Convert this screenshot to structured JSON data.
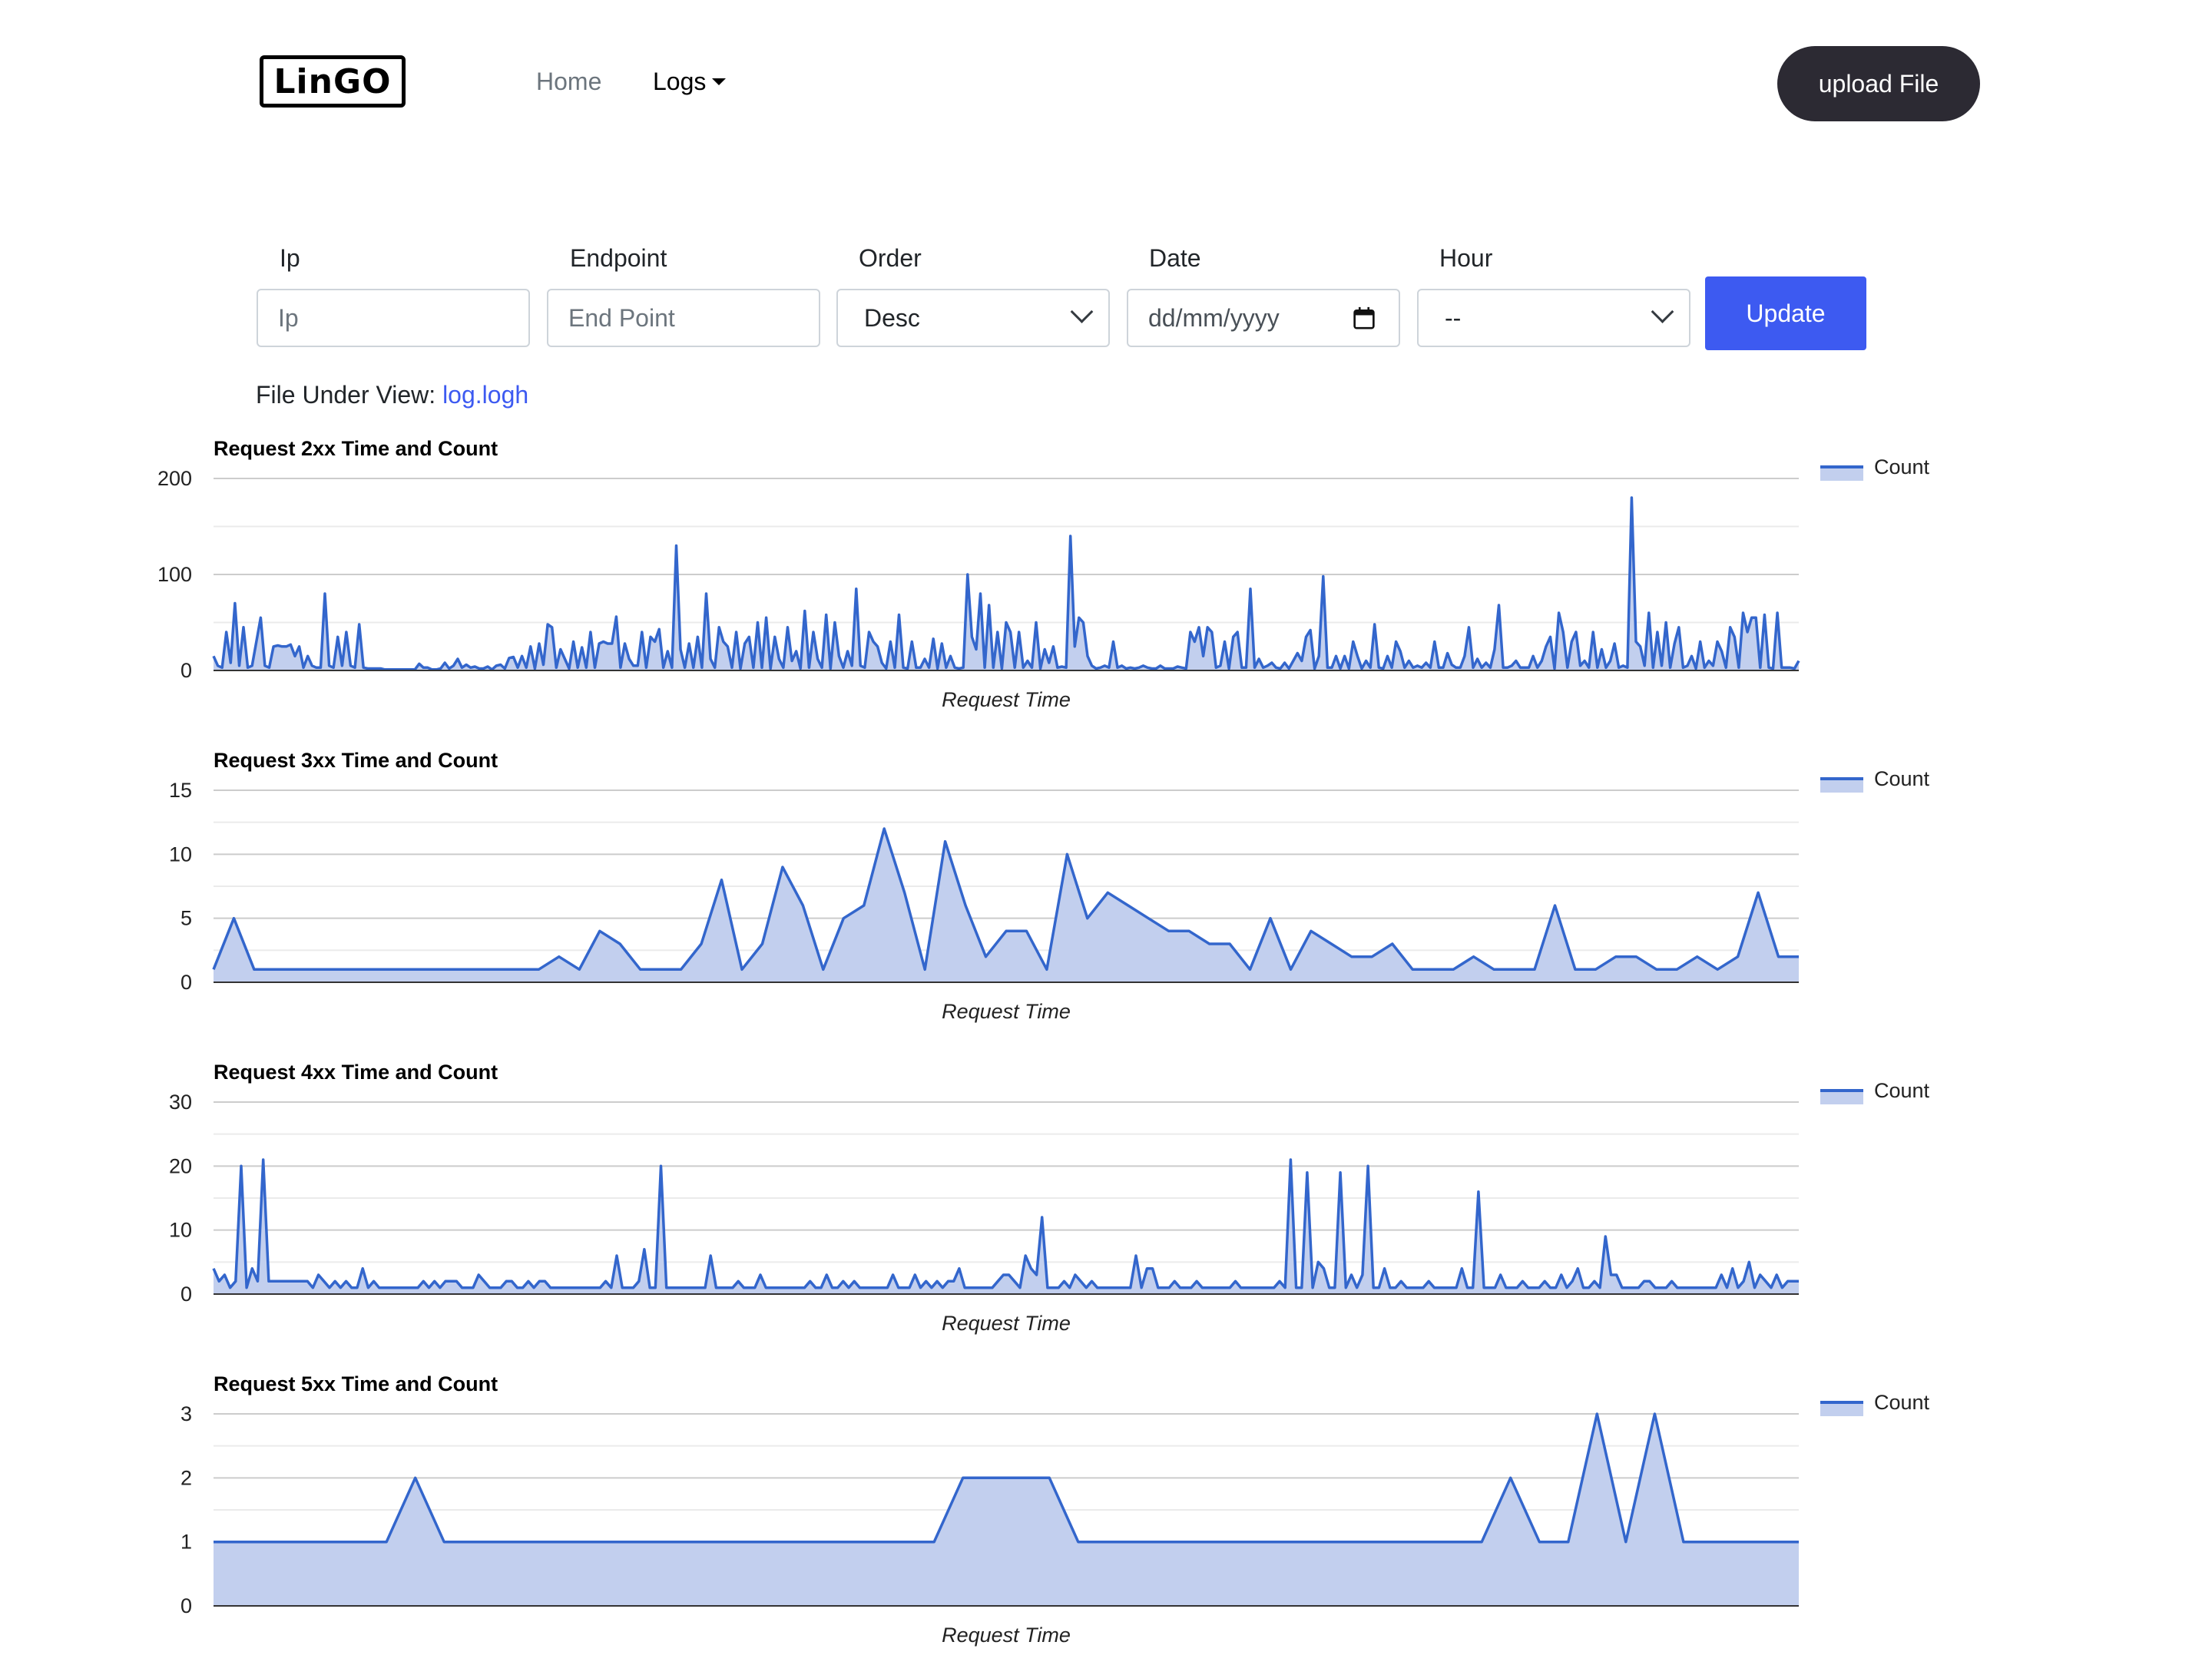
{
  "header": {
    "logo_text": "LinGO",
    "nav": {
      "home": "Home",
      "logs": "Logs"
    },
    "upload_label": "upload File"
  },
  "filters": {
    "ip": {
      "label": "Ip",
      "placeholder": "Ip"
    },
    "endpoint": {
      "label": "Endpoint",
      "placeholder": "End Point"
    },
    "order": {
      "label": "Order",
      "value": "Desc"
    },
    "date": {
      "label": "Date",
      "placeholder": "dd/mm/yyyy"
    },
    "hour": {
      "label": "Hour",
      "value": "--"
    },
    "update_label": "Update"
  },
  "file_under_view": {
    "label": "File Under View:",
    "file": "log.logh"
  },
  "colors": {
    "series": "#3366cc",
    "fill": "#c2cfee",
    "grid": "#cccccc",
    "accent": "#3d5af1",
    "upload_bg": "#2c2a33"
  },
  "chart_data": [
    {
      "type": "area",
      "title": "Request 2xx Time and Count",
      "xlabel": "Request Time",
      "ylabel": "",
      "ylim": [
        0,
        200
      ],
      "yticks": [
        0,
        100,
        200
      ],
      "legend": "right",
      "series": [
        {
          "name": "Count",
          "values": [
            15,
            5,
            3,
            40,
            8,
            70,
            5,
            45,
            3,
            5,
            30,
            55,
            5,
            3,
            25,
            26,
            25,
            25,
            27,
            15,
            25,
            3,
            15,
            5,
            3,
            3,
            80,
            5,
            3,
            35,
            5,
            40,
            5,
            3,
            48,
            3,
            2,
            2,
            2,
            2,
            1,
            1,
            1,
            1,
            1,
            1,
            1,
            1,
            7,
            3,
            3,
            1,
            1,
            2,
            8,
            2,
            5,
            12,
            3,
            6,
            3,
            4,
            2,
            2,
            4,
            1,
            5,
            6,
            2,
            13,
            14,
            3,
            15,
            3,
            25,
            2,
            28,
            6,
            48,
            45,
            3,
            22,
            12,
            2,
            30,
            3,
            24,
            3,
            40,
            3,
            28,
            30,
            28,
            28,
            56,
            3,
            28,
            12,
            5,
            5,
            40,
            3,
            35,
            30,
            43,
            3,
            20,
            3,
            130,
            22,
            3,
            28,
            3,
            35,
            3,
            80,
            12,
            3,
            45,
            30,
            25,
            3,
            40,
            2,
            28,
            35,
            3,
            50,
            3,
            55,
            2,
            35,
            12,
            3,
            45,
            10,
            20,
            2,
            62,
            3,
            40,
            12,
            3,
            58,
            2,
            50,
            15,
            3,
            20,
            5,
            85,
            5,
            3,
            40,
            30,
            25,
            8,
            2,
            30,
            3,
            58,
            3,
            2,
            30,
            3,
            3,
            12,
            3,
            33,
            2,
            28,
            3,
            15,
            3,
            2,
            3,
            100,
            35,
            22,
            80,
            3,
            68,
            3,
            40,
            2,
            50,
            40,
            3,
            40,
            3,
            10,
            3,
            50,
            2,
            22,
            8,
            25,
            3,
            4,
            3,
            140,
            25,
            55,
            50,
            15,
            5,
            2,
            3,
            5,
            3,
            30,
            3,
            5,
            2,
            3,
            2,
            3,
            5,
            3,
            2,
            2,
            5,
            2,
            2,
            2,
            4,
            3,
            2,
            40,
            30,
            45,
            15,
            45,
            40,
            3,
            5,
            30,
            2,
            35,
            40,
            3,
            3,
            85,
            3,
            12,
            3,
            5,
            8,
            3,
            2,
            8,
            2,
            10,
            18,
            10,
            35,
            42,
            2,
            15,
            98,
            3,
            3,
            15,
            2,
            15,
            2,
            30,
            15,
            2,
            10,
            3,
            48,
            3,
            2,
            15,
            3,
            30,
            20,
            3,
            10,
            3,
            5,
            3,
            8,
            3,
            30,
            3,
            3,
            18,
            6,
            3,
            3,
            15,
            45,
            3,
            12,
            3,
            8,
            3,
            22,
            68,
            3,
            3,
            5,
            10,
            3,
            3,
            3,
            15,
            3,
            10,
            25,
            35,
            2,
            60,
            40,
            3,
            30,
            40,
            5,
            10,
            3,
            40,
            3,
            22,
            3,
            10,
            28,
            3,
            5,
            3,
            180,
            30,
            25,
            5,
            60,
            3,
            40,
            5,
            50,
            3,
            28,
            45,
            3,
            5,
            15,
            2,
            30,
            3,
            10,
            5,
            30,
            20,
            3,
            45,
            35,
            3,
            60,
            40,
            55,
            55,
            3,
            58,
            3,
            2,
            60,
            3,
            3,
            3,
            2,
            10
          ]
        }
      ]
    },
    {
      "type": "area",
      "title": "Request 3xx Time and Count",
      "xlabel": "Request Time",
      "ylabel": "",
      "ylim": [
        0,
        15
      ],
      "yticks": [
        0,
        5,
        10,
        15
      ],
      "legend": "right",
      "series": [
        {
          "name": "Count",
          "values": [
            1,
            5,
            1,
            1,
            1,
            1,
            1,
            1,
            1,
            1,
            1,
            1,
            1,
            1,
            1,
            1,
            1,
            2,
            1,
            4,
            3,
            1,
            1,
            1,
            3,
            8,
            1,
            3,
            9,
            6,
            1,
            5,
            6,
            12,
            7,
            1,
            11,
            6,
            2,
            4,
            4,
            1,
            10,
            5,
            7,
            6,
            5,
            4,
            4,
            3,
            3,
            1,
            5,
            1,
            4,
            3,
            2,
            2,
            3,
            1,
            1,
            1,
            2,
            1,
            1,
            1,
            6,
            1,
            1,
            2,
            2,
            1,
            1,
            2,
            1,
            2,
            7,
            2,
            2
          ]
        }
      ]
    },
    {
      "type": "area",
      "title": "Request 4xx Time and Count",
      "xlabel": "Request Time",
      "ylabel": "",
      "ylim": [
        0,
        30
      ],
      "yticks": [
        0,
        10,
        20,
        30
      ],
      "legend": "right",
      "series": [
        {
          "name": "Count",
          "values": [
            4,
            2,
            3,
            1,
            2,
            20,
            1,
            4,
            2,
            21,
            2,
            2,
            2,
            2,
            2,
            2,
            2,
            2,
            1,
            3,
            2,
            1,
            2,
            1,
            2,
            1,
            1,
            4,
            1,
            2,
            1,
            1,
            1,
            1,
            1,
            1,
            1,
            1,
            2,
            1,
            2,
            1,
            2,
            2,
            2,
            1,
            1,
            1,
            3,
            2,
            1,
            1,
            1,
            2,
            2,
            1,
            1,
            2,
            1,
            2,
            2,
            1,
            1,
            1,
            1,
            1,
            1,
            1,
            1,
            1,
            1,
            2,
            1,
            6,
            1,
            1,
            1,
            2,
            7,
            1,
            1,
            20,
            1,
            1,
            1,
            1,
            1,
            1,
            1,
            1,
            6,
            1,
            1,
            1,
            1,
            2,
            1,
            1,
            1,
            3,
            1,
            1,
            1,
            1,
            1,
            1,
            1,
            1,
            2,
            1,
            1,
            3,
            1,
            1,
            2,
            1,
            2,
            1,
            1,
            1,
            1,
            1,
            1,
            3,
            1,
            1,
            1,
            3,
            1,
            2,
            1,
            2,
            1,
            2,
            2,
            4,
            1,
            1,
            1,
            1,
            1,
            1,
            2,
            3,
            3,
            2,
            1,
            6,
            4,
            3,
            12,
            1,
            1,
            1,
            2,
            1,
            3,
            2,
            1,
            2,
            1,
            1,
            1,
            1,
            1,
            1,
            1,
            6,
            1,
            4,
            4,
            1,
            1,
            1,
            2,
            1,
            1,
            1,
            2,
            1,
            1,
            1,
            1,
            1,
            1,
            2,
            1,
            1,
            1,
            1,
            1,
            1,
            1,
            2,
            1,
            21,
            1,
            1,
            19,
            1,
            5,
            4,
            1,
            1,
            19,
            1,
            3,
            1,
            3,
            20,
            1,
            1,
            4,
            1,
            1,
            2,
            1,
            1,
            1,
            1,
            2,
            1,
            1,
            1,
            1,
            1,
            4,
            1,
            1,
            16,
            1,
            1,
            1,
            3,
            1,
            1,
            1,
            2,
            1,
            1,
            1,
            2,
            1,
            1,
            3,
            1,
            2,
            4,
            1,
            1,
            2,
            1,
            9,
            3,
            3,
            1,
            1,
            1,
            1,
            2,
            2,
            1,
            1,
            1,
            2,
            1,
            1,
            1,
            1,
            1,
            1,
            1,
            1,
            3,
            1,
            4,
            1,
            2,
            5,
            1,
            3,
            2,
            1,
            3,
            1,
            2,
            2,
            2
          ]
        }
      ]
    },
    {
      "type": "area",
      "title": "Request 5xx Time and Count",
      "xlabel": "Request Time",
      "ylabel": "",
      "ylim": [
        0,
        3
      ],
      "yticks": [
        0,
        1,
        2,
        3
      ],
      "legend": "right",
      "series": [
        {
          "name": "Count",
          "values": [
            1,
            1,
            1,
            1,
            1,
            1,
            1,
            2,
            1,
            1,
            1,
            1,
            1,
            1,
            1,
            1,
            1,
            1,
            1,
            1,
            1,
            1,
            1,
            1,
            1,
            1,
            2,
            2,
            2,
            2,
            1,
            1,
            1,
            1,
            1,
            1,
            1,
            1,
            1,
            1,
            1,
            1,
            1,
            1,
            1,
            2,
            1,
            1,
            3,
            1,
            3,
            1,
            1,
            1,
            1,
            1
          ]
        }
      ]
    }
  ]
}
